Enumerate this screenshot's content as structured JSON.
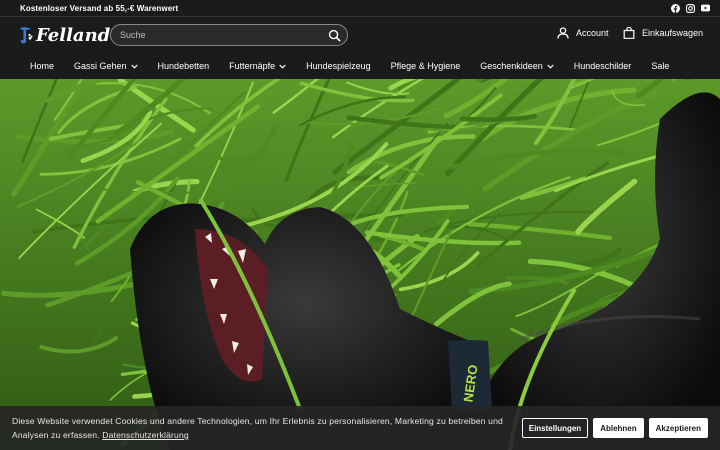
{
  "announcement": {
    "text": "Kostenloser Versand ab 55,-€ Warenwert"
  },
  "socials": [
    {
      "icon": "facebook-icon"
    },
    {
      "icon": "instagram-icon"
    },
    {
      "icon": "youtube-icon"
    }
  ],
  "header": {
    "logo_text": "Fellando",
    "search_placeholder": "Suche",
    "account_label": "Account",
    "cart_label": "Einkaufswagen"
  },
  "nav": {
    "items": [
      {
        "label": "Home"
      },
      {
        "label": "Gassi Gehen"
      },
      {
        "label": "Hundebetten"
      },
      {
        "label": "Futternäpfe"
      },
      {
        "label": "Hundespielzeug"
      },
      {
        "label": "Pflege & Hygiene"
      },
      {
        "label": "Geschenkideen"
      },
      {
        "label": "Hundeschilder"
      },
      {
        "label": "Sale"
      }
    ]
  },
  "hero": {
    "collar_text": "NERO"
  },
  "cookie": {
    "text": "Diese Website verwendet Cookies und andere Technologien, um Ihr Erlebnis zu personalisieren, Marketing zu betreiben und Analysen zu erfassen.",
    "link_label": "Datenschutzerklärung",
    "settings_label": "Einstellungen",
    "decline_label": "Ablehnen",
    "accept_label": "Akzeptieren"
  },
  "colors": {
    "background": "#1b1b1b",
    "accent": "#ffffff",
    "grass": "#4f8a22"
  }
}
